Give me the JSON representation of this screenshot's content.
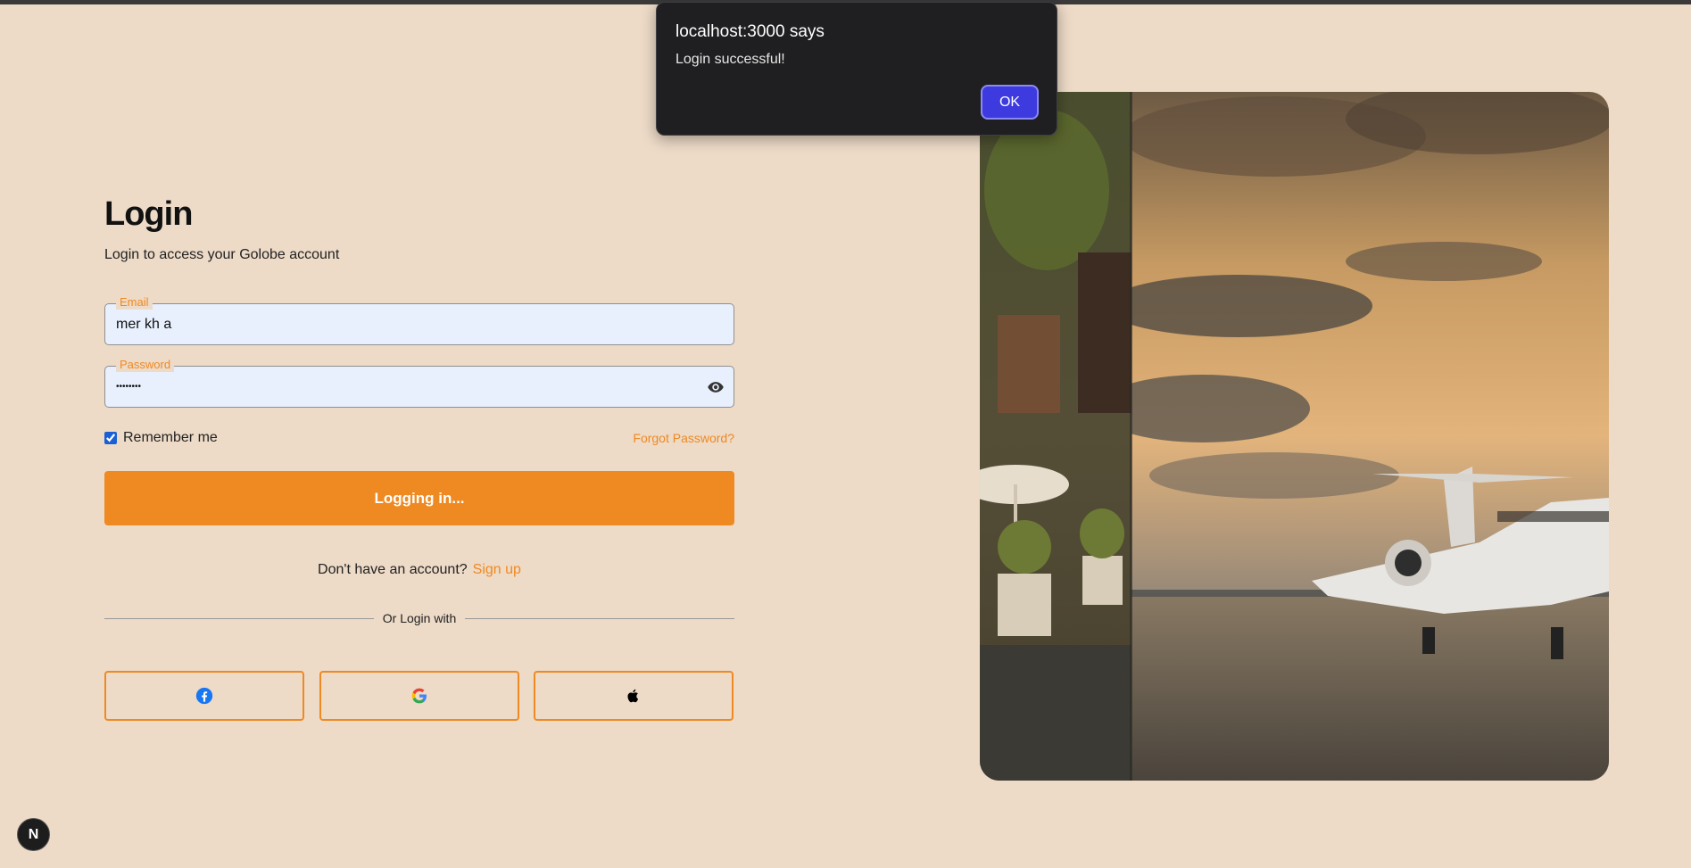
{
  "login": {
    "title": "Login",
    "subtitle": "Login to access your Golobe account",
    "email_label": "Email",
    "email_value": "mer kh a",
    "password_label": "Password",
    "password_value": "••••••••",
    "remember_label": "Remember me",
    "remember_checked": true,
    "forgot_label": "Forgot Password?",
    "submit_label": "Logging in...",
    "no_account_text": "Don't have an account?",
    "signup_label": "Sign up",
    "divider_label": "Or Login with",
    "social_providers": [
      "facebook-icon",
      "google-icon",
      "apple-icon"
    ]
  },
  "dialog": {
    "title": "localhost:3000 says",
    "message": "Login successful!",
    "ok_label": "OK"
  },
  "badge": {
    "label": "N"
  },
  "colors": {
    "background": "#eddac7",
    "accent": "#ef8a22",
    "input_bg": "#e8f0fe",
    "dialog_bg": "#1f1f22",
    "dialog_button": "#3d3ae0"
  }
}
